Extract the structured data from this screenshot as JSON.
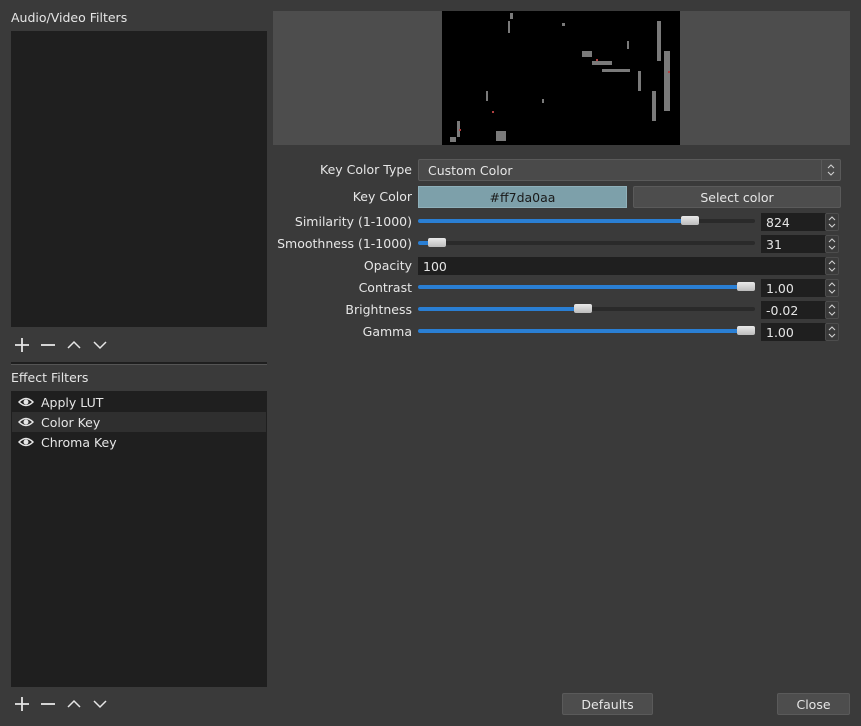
{
  "audio_video_filters": {
    "title": "Audio/Video Filters",
    "toolbar": [
      "add-icon",
      "remove-icon",
      "move-up-icon",
      "move-down-icon"
    ]
  },
  "effect_filters": {
    "title": "Effect Filters",
    "items": [
      {
        "label": "Apply LUT",
        "visible_icon": "eye-icon",
        "selected": false
      },
      {
        "label": "Color Key",
        "visible_icon": "eye-icon",
        "selected": true
      },
      {
        "label": "Chroma Key",
        "visible_icon": "eye-icon",
        "selected": false
      }
    ],
    "toolbar": [
      "add-icon",
      "remove-icon",
      "move-up-icon",
      "move-down-icon"
    ]
  },
  "properties": {
    "key_color_type": {
      "label": "Key Color Type",
      "value": "Custom Color"
    },
    "key_color": {
      "label": "Key Color",
      "value": "#ff7da0aa",
      "swatch": "#7da0aa",
      "button": "Select color"
    },
    "similarity": {
      "label": "Similarity (1-1000)",
      "value": "824",
      "level": 0.824
    },
    "smoothness": {
      "label": "Smoothness (1-1000)",
      "value": "31",
      "level": 0.03
    },
    "opacity": {
      "label": "Opacity",
      "value": "100"
    },
    "contrast": {
      "label": "Contrast",
      "value": "1.00",
      "level": 1.0
    },
    "brightness": {
      "label": "Brightness",
      "value": "-0.02",
      "level": 0.49
    },
    "gamma": {
      "label": "Gamma",
      "value": "1.00",
      "level": 1.0
    }
  },
  "footer": {
    "defaults": "Defaults",
    "close": "Close"
  },
  "colors": {
    "background": "#3a3a3a",
    "panel": "#1f1f1f",
    "accent": "#2a7fd4"
  }
}
